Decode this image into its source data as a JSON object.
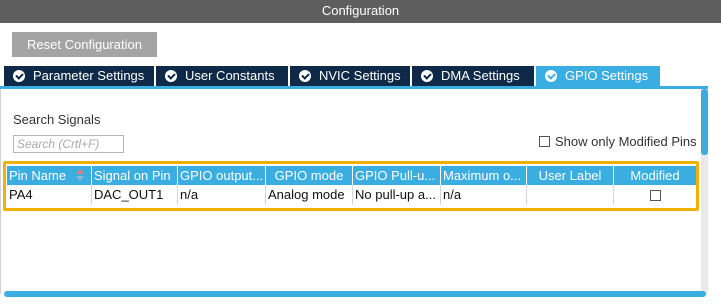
{
  "window": {
    "title": "Configuration"
  },
  "toolbar": {
    "reset_label": "Reset Configuration"
  },
  "tabs": [
    {
      "label": "Parameter Settings",
      "active": false
    },
    {
      "label": "User Constants",
      "active": false
    },
    {
      "label": "NVIC Settings",
      "active": false
    },
    {
      "label": "DMA Settings",
      "active": false
    },
    {
      "label": "GPIO Settings",
      "active": true
    }
  ],
  "search": {
    "label": "Search Signals",
    "placeholder": "Search (Crtl+F)",
    "value": ""
  },
  "filter": {
    "only_modified_label": "Show only Modified Pins",
    "checked": false
  },
  "table": {
    "columns": [
      "Pin Name",
      "Signal on Pin",
      "GPIO output...",
      "GPIO mode",
      "GPIO Pull-u...",
      "Maximum o...",
      "User Label",
      "Modified"
    ],
    "rows": [
      {
        "pin": "PA4",
        "signal": "DAC_OUT1",
        "gpio_output": "n/a",
        "gpio_mode": "Analog mode",
        "pull": "No pull-up a...",
        "max": "n/a",
        "user_label": "",
        "modified": false
      }
    ]
  },
  "colors": {
    "accent": "#3aaee0",
    "tab_dark": "#0e2a48",
    "highlight": "#f0b100",
    "title_bar": "#5e5e5e"
  }
}
